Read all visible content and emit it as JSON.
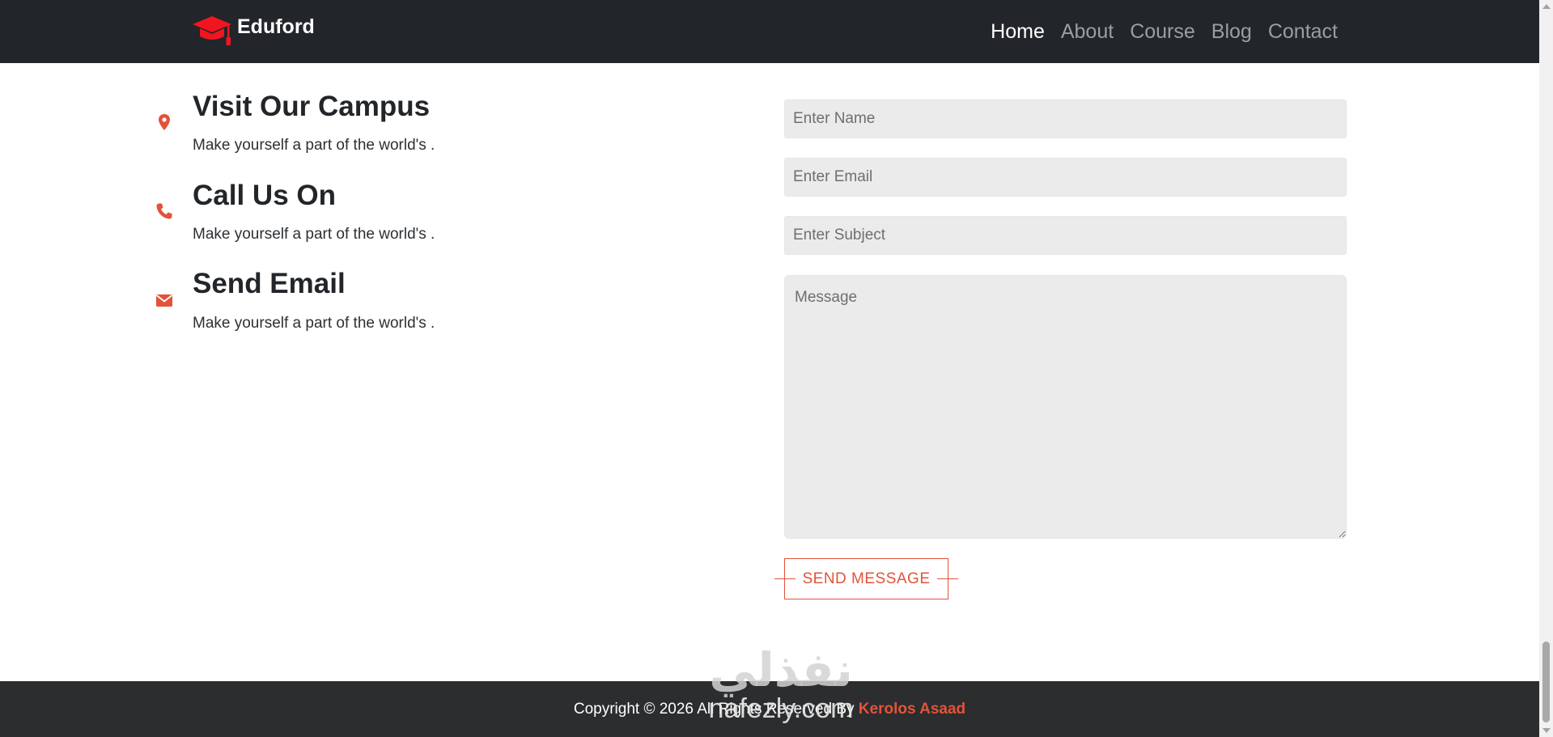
{
  "brand": {
    "name": "Eduford",
    "icon": "graduation-cap-icon"
  },
  "nav": {
    "items": [
      {
        "label": "Home",
        "active": true
      },
      {
        "label": "About",
        "active": false
      },
      {
        "label": "Course",
        "active": false
      },
      {
        "label": "Blog",
        "active": false
      },
      {
        "label": "Contact",
        "active": false
      }
    ]
  },
  "contact_info": [
    {
      "icon": "map-pin-icon",
      "title": "Visit Our Campus",
      "text": "Make yourself a part of the world's ."
    },
    {
      "icon": "phone-icon",
      "title": "Call Us On",
      "text": "Make yourself a part of the world's ."
    },
    {
      "icon": "envelope-icon",
      "title": "Send Email",
      "text": "Make yourself a part of the world's ."
    }
  ],
  "form": {
    "name_placeholder": "Enter Name",
    "email_placeholder": "Enter Email",
    "subject_placeholder": "Enter Subject",
    "message_placeholder": "Message",
    "submit_label": "SEND MESSAGE"
  },
  "footer": {
    "copyright_text": "Copyright © 2026 All Rights Reserved By ",
    "author": "Kerolos Asaad"
  },
  "watermark": {
    "arabic": "نفذلي",
    "latin": "nafezly.com"
  },
  "colors": {
    "nav_bg": "#222529",
    "accent": "#e2533a",
    "field_bg": "#ebebeb",
    "footer_bg": "#2b2d2f",
    "logo_red": "#f0151f"
  }
}
